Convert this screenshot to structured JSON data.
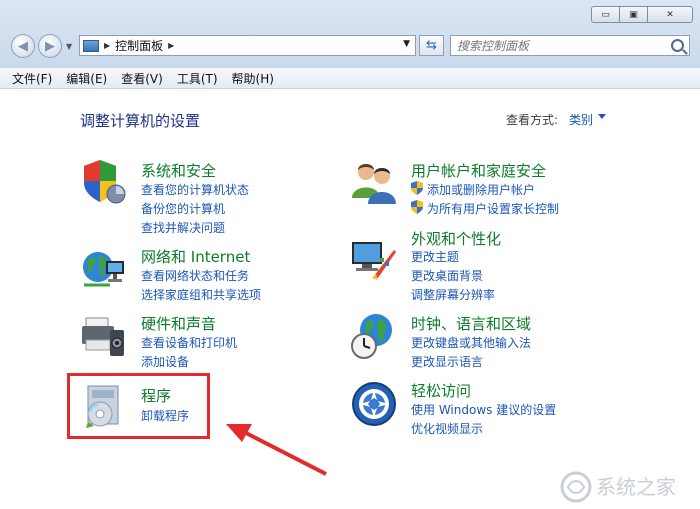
{
  "titlebar": {
    "buttons": [
      {
        "name": "minimize-button",
        "glyph": "▭"
      },
      {
        "name": "maximize-button",
        "glyph": "▣"
      },
      {
        "name": "close-button",
        "glyph": "✕"
      }
    ]
  },
  "address": {
    "path": "控制面板",
    "arrow_glyph": "▶",
    "drop_glyph": "▼"
  },
  "search": {
    "placeholder": "搜索控制面板"
  },
  "menu": [
    "文件(F)",
    "编辑(E)",
    "查看(V)",
    "工具(T)",
    "帮助(H)"
  ],
  "main": {
    "title": "调整计算机的设置",
    "view_by_label": "查看方式:",
    "view_by_value": "类别"
  },
  "categories": {
    "system_security": {
      "title": "系统和安全",
      "links": [
        "查看您的计算机状态",
        "备份您的计算机",
        "查找并解决问题"
      ]
    },
    "network": {
      "title": "网络和 Internet",
      "links": [
        "查看网络状态和任务",
        "选择家庭组和共享选项"
      ]
    },
    "hardware": {
      "title": "硬件和声音",
      "links": [
        "查看设备和打印机",
        "添加设备"
      ]
    },
    "programs": {
      "title": "程序",
      "links": [
        "卸载程序"
      ]
    },
    "user_accounts": {
      "title": "用户帐户和家庭安全",
      "links": [
        "添加或删除用户帐户",
        "为所有用户设置家长控制"
      ]
    },
    "appearance": {
      "title": "外观和个性化",
      "links": [
        "更改主题",
        "更改桌面背景",
        "调整屏幕分辨率"
      ]
    },
    "clock": {
      "title": "时钟、语言和区域",
      "links": [
        "更改键盘或其他输入法",
        "更改显示语言"
      ]
    },
    "ease": {
      "title": "轻松访问",
      "links": [
        "使用 Windows 建议的设置",
        "优化视频显示"
      ]
    }
  },
  "watermark": {
    "text": "系统之家"
  },
  "colors": {
    "category_title": "#0b7d2a",
    "link": "#1c57b8",
    "page_title": "#1e3287",
    "annotation_red": "#e32b2b"
  }
}
